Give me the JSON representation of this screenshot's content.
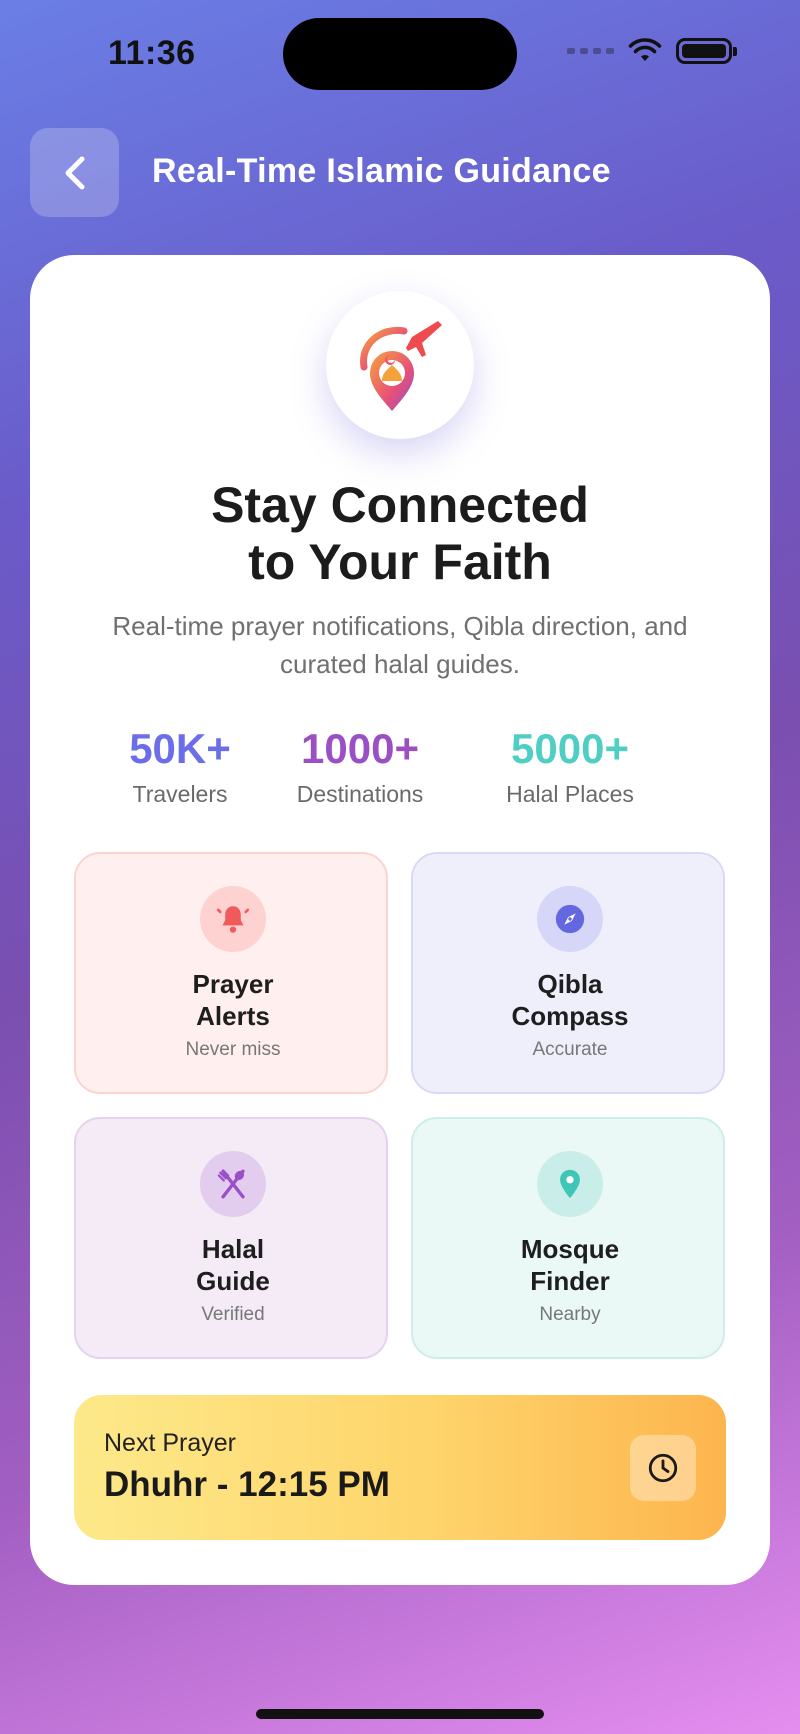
{
  "status_bar": {
    "time": "11:36"
  },
  "header": {
    "title": "Real-Time Islamic Guidance"
  },
  "hero": {
    "headline_line1": "Stay Connected",
    "headline_line2": "to Your Faith",
    "subtitle": "Real-time prayer notifications, Qibla direction, and curated halal guides."
  },
  "stats": [
    {
      "value": "50K+",
      "label": "Travelers",
      "color": "#6b6ee8"
    },
    {
      "value": "1000+",
      "label": "Destinations",
      "color": "#9a4fc4"
    },
    {
      "value": "5000+",
      "label": "Halal Places",
      "color": "#4fcfc3"
    }
  ],
  "features": [
    {
      "title_line1": "Prayer",
      "title_line2": "Alerts",
      "subtitle": "Never miss",
      "icon": "bell-icon",
      "accent": "#f15a5a"
    },
    {
      "title_line1": "Qibla",
      "title_line2": "Compass",
      "subtitle": "Accurate",
      "icon": "compass-icon",
      "accent": "#6468e0"
    },
    {
      "title_line1": "Halal",
      "title_line2": "Guide",
      "subtitle": "Verified",
      "icon": "utensils-icon",
      "accent": "#9b4fc6"
    },
    {
      "title_line1": "Mosque",
      "title_line2": "Finder",
      "subtitle": "Nearby",
      "icon": "location-pin-icon",
      "accent": "#3fc6b8"
    }
  ],
  "next_prayer": {
    "label": "Next Prayer",
    "value": "Dhuhr - 12:15 PM"
  }
}
